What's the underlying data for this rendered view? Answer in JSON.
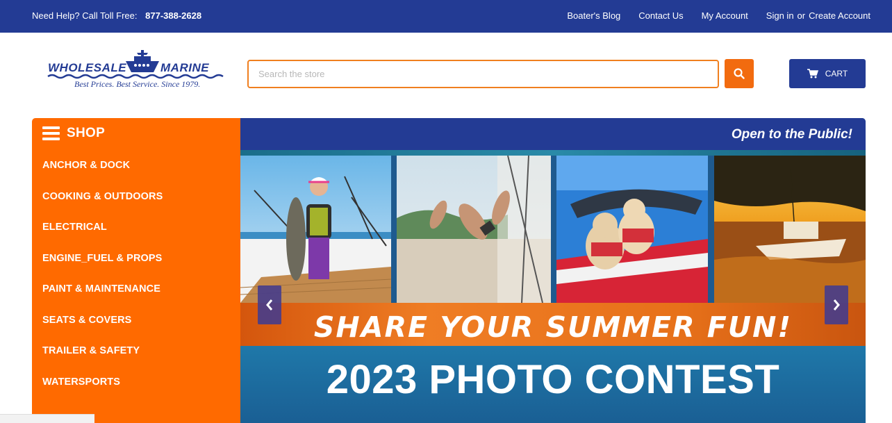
{
  "topbar": {
    "help_text": "Need Help? Call Toll Free:",
    "phone": "877-388-2628",
    "blog": "Boater's Blog",
    "contact": "Contact Us",
    "account": "My Account",
    "signin": "Sign in",
    "or": "or",
    "create": "Create Account"
  },
  "logo": {
    "name": "WHOLESALE MARINE",
    "tagline": "Best Prices. Best Service. Since 1979."
  },
  "search": {
    "placeholder": "Search the store",
    "value": ""
  },
  "cart": {
    "label": "CART"
  },
  "sidebar": {
    "title": "SHOP",
    "categories": [
      "ANCHOR & DOCK",
      "COOKING & OUTDOORS",
      "ELECTRICAL",
      "ENGINE_FUEL & PROPS",
      "PAINT & MAINTENANCE",
      "SEATS & COVERS",
      "TRAILER & SAFETY",
      "WATERSPORTS"
    ]
  },
  "banner": {
    "tagline": "Open to the Public!",
    "headline": "SHARE YOUR SUMMER FUN!",
    "subheadline": "2023 PHOTO CONTEST"
  },
  "colors": {
    "brand_blue": "#233b94",
    "brand_orange": "#ff6a00",
    "search_orange": "#f26b0f"
  }
}
